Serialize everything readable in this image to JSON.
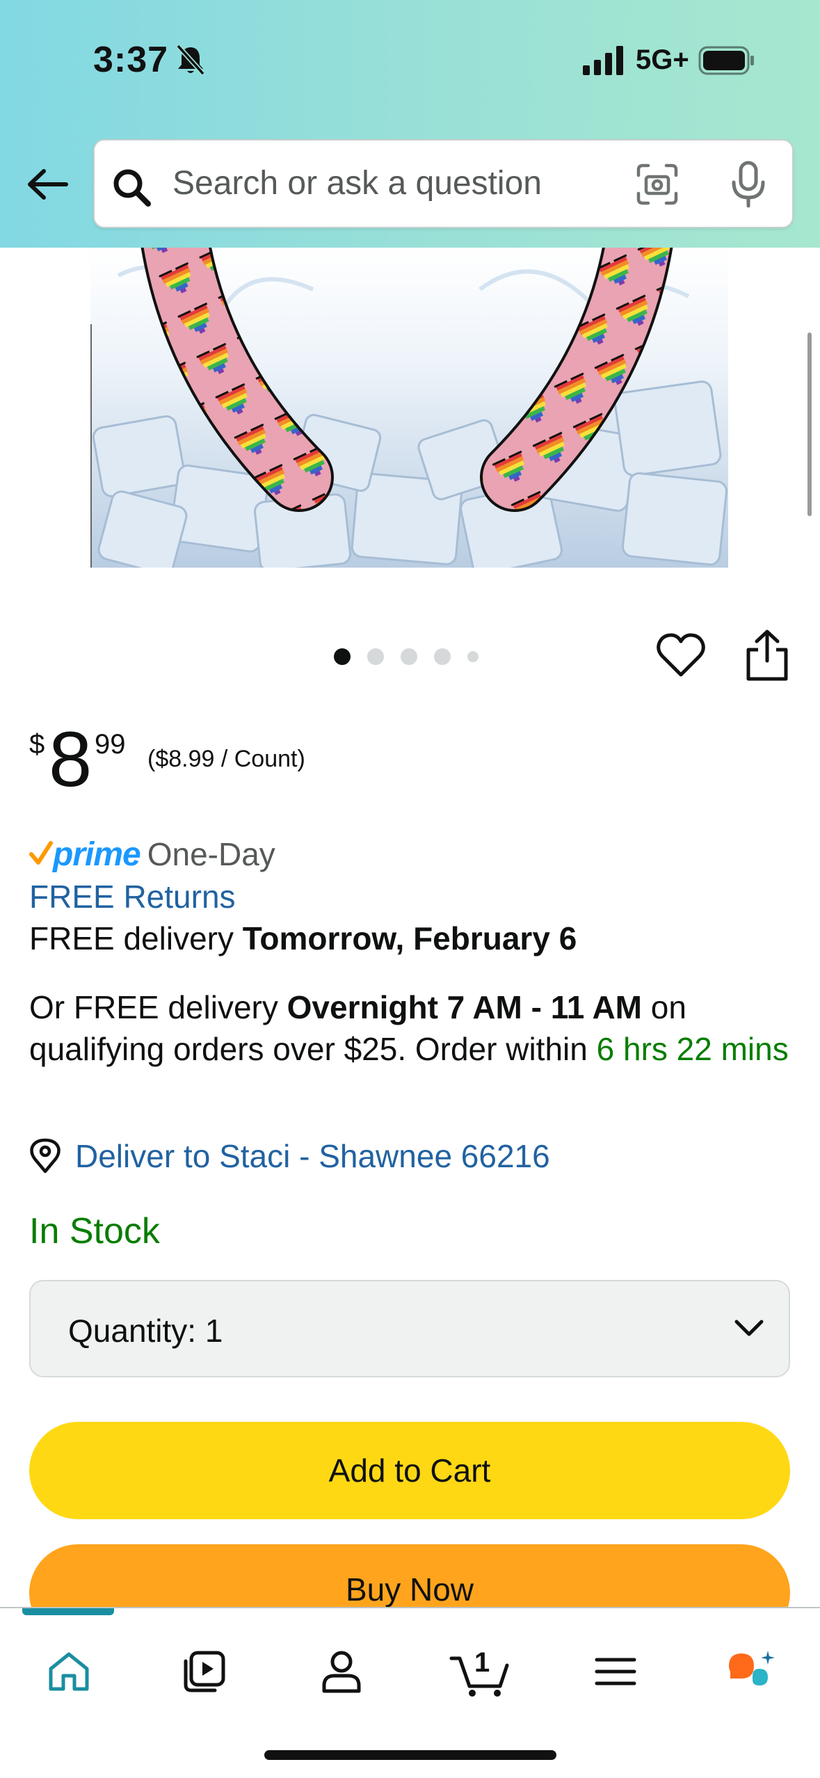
{
  "status_bar": {
    "time": "3:37",
    "network": "5G+"
  },
  "search": {
    "placeholder": "Search or ask a question"
  },
  "gallery": {
    "image_count": 5,
    "active_index": 0
  },
  "price": {
    "symbol": "$",
    "whole": "8",
    "fraction": "99",
    "unit_price": "($8.99 / Count)"
  },
  "delivery": {
    "prime_label": "prime",
    "prime_speed": "One-Day",
    "free_returns": "FREE Returns",
    "free_delivery_prefix": "FREE delivery ",
    "free_delivery_date": "Tomorrow, February 6",
    "overnight_prefix": "Or FREE delivery ",
    "overnight_window": "Overnight 7 AM - 11 AM",
    "overnight_suffix": " on qualifying orders over $25. Order within ",
    "overnight_countdown": "6 hrs 22 mins",
    "deliver_to": "Deliver to Staci - Shawnee 66216"
  },
  "stock": {
    "status": "In Stock"
  },
  "quantity": {
    "label": "Quantity:  1"
  },
  "buttons": {
    "add_to_cart": "Add to Cart",
    "buy_now": "Buy Now"
  },
  "bottom_nav": {
    "cart_count": "1",
    "items": [
      "home-icon",
      "video-icon",
      "account-icon",
      "cart-icon",
      "menu-icon",
      "rufus-icon"
    ]
  },
  "colors": {
    "header_gradient_start": "#82d8e3",
    "header_gradient_end": "#a6e7cf",
    "link_blue": "#2162a1",
    "prime_blue": "#1a98ff",
    "stock_green": "#077d00",
    "add_to_cart_yellow": "#ffd814",
    "buy_now_orange": "#ffa41c",
    "nav_accent": "#1a8ea1"
  }
}
